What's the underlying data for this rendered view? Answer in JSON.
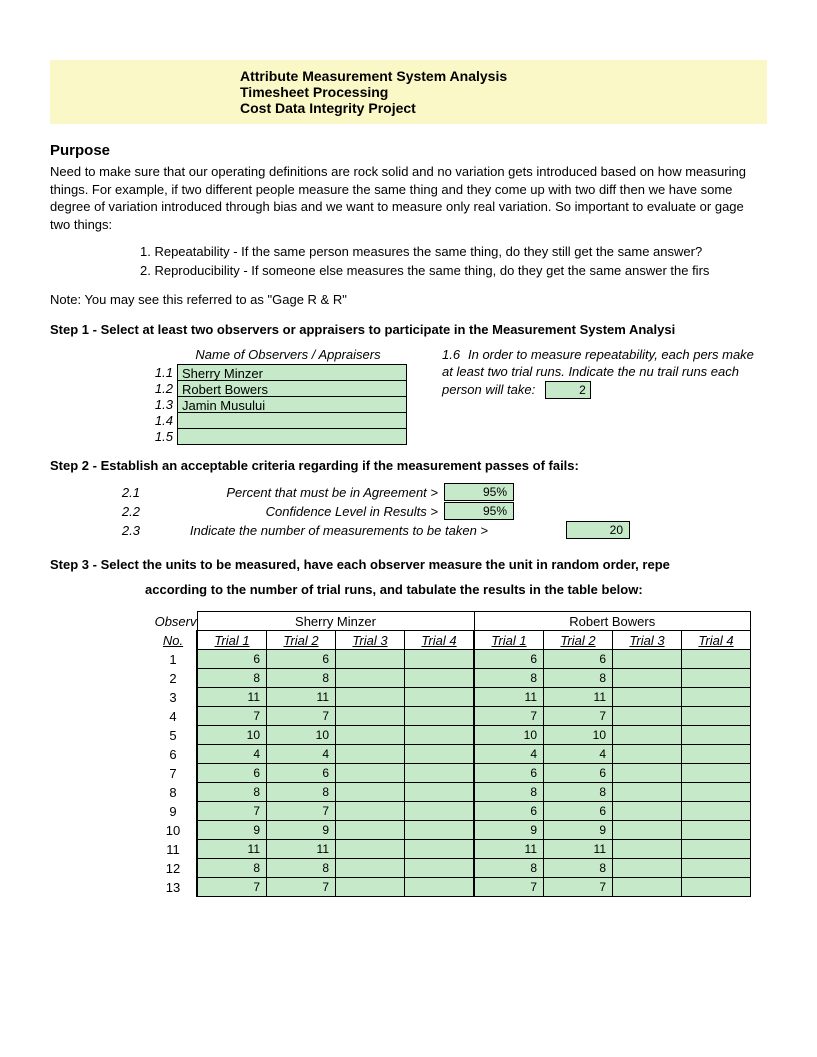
{
  "header": {
    "line1": "Attribute Measurement System Analysis",
    "line2": "Timesheet Processing",
    "line3": "Cost Data Integrity Project"
  },
  "purpose": {
    "title": "Purpose",
    "body": "Need to make sure that our operating definitions are rock solid and no variation gets introduced based on how measuring things. For example, if two different people measure the same thing and they come up with two diff then we have some degree of variation introduced through bias and we want to measure only real variation. So important to evaluate or gage two things:",
    "item1": "1. Repeatability - If the same person measures the same thing, do they still get the same answer?",
    "item2": "2. Reproducibility - If someone else measures the same thing, do they get the same answer the firs",
    "note": "Note: You may see this referred to as \"Gage R & R\""
  },
  "step1": {
    "title": "Step 1 - Select at least two observers or appraisers to participate in the Measurement System Analysi",
    "obs_header": "Name of Observers / Appraisers",
    "rows": [
      {
        "num": "1.1",
        "name": "Sherry Minzer"
      },
      {
        "num": "1.2",
        "name": "Robert Bowers"
      },
      {
        "num": "1.3",
        "name": "Jamin Musului"
      },
      {
        "num": "1.4",
        "name": ""
      },
      {
        "num": "1.5",
        "name": ""
      }
    ],
    "note_num": "1.6",
    "note_text": "In order to measure repeatability, each pers make at least two trial runs. Indicate the nu trail runs each person will take:",
    "trial_runs": "2"
  },
  "step2": {
    "title": "Step 2 - Establish an acceptable criteria regarding if the measurement passes of fails:",
    "r1": {
      "num": "2.1",
      "label": "Percent that must be in Agreement >",
      "val": "95%"
    },
    "r2": {
      "num": "2.2",
      "label": "Confidence Level in Results >",
      "val": "95%"
    },
    "r3": {
      "num": "2.3",
      "label": "Indicate the number of measurements to be taken >",
      "val": "20"
    }
  },
  "step3": {
    "title_a": "Step 3 - Select the units to be measured, have each observer measure the unit in random order, repe",
    "title_b": "according to the number of trial runs, and tabulate the results in the table below:",
    "observ_label": "Observ",
    "no_label": "No.",
    "names": [
      "Sherry Minzer",
      "Robert Bowers"
    ],
    "trials": [
      "Trial 1",
      "Trial 2",
      "Trial 3",
      "Trial 4"
    ],
    "rows": [
      {
        "no": "1",
        "a": [
          "6",
          "6",
          "",
          ""
        ],
        "b": [
          "6",
          "6",
          "",
          ""
        ]
      },
      {
        "no": "2",
        "a": [
          "8",
          "8",
          "",
          ""
        ],
        "b": [
          "8",
          "8",
          "",
          ""
        ]
      },
      {
        "no": "3",
        "a": [
          "11",
          "11",
          "",
          ""
        ],
        "b": [
          "11",
          "11",
          "",
          ""
        ]
      },
      {
        "no": "4",
        "a": [
          "7",
          "7",
          "",
          ""
        ],
        "b": [
          "7",
          "7",
          "",
          ""
        ]
      },
      {
        "no": "5",
        "a": [
          "10",
          "10",
          "",
          ""
        ],
        "b": [
          "10",
          "10",
          "",
          ""
        ]
      },
      {
        "no": "6",
        "a": [
          "4",
          "4",
          "",
          ""
        ],
        "b": [
          "4",
          "4",
          "",
          ""
        ]
      },
      {
        "no": "7",
        "a": [
          "6",
          "6",
          "",
          ""
        ],
        "b": [
          "6",
          "6",
          "",
          ""
        ]
      },
      {
        "no": "8",
        "a": [
          "8",
          "8",
          "",
          ""
        ],
        "b": [
          "8",
          "8",
          "",
          ""
        ]
      },
      {
        "no": "9",
        "a": [
          "7",
          "7",
          "",
          ""
        ],
        "b": [
          "6",
          "6",
          "",
          ""
        ]
      },
      {
        "no": "10",
        "a": [
          "9",
          "9",
          "",
          ""
        ],
        "b": [
          "9",
          "9",
          "",
          ""
        ]
      },
      {
        "no": "11",
        "a": [
          "11",
          "11",
          "",
          ""
        ],
        "b": [
          "11",
          "11",
          "",
          ""
        ]
      },
      {
        "no": "12",
        "a": [
          "8",
          "8",
          "",
          ""
        ],
        "b": [
          "8",
          "8",
          "",
          ""
        ]
      },
      {
        "no": "13",
        "a": [
          "7",
          "7",
          "",
          ""
        ],
        "b": [
          "7",
          "7",
          "",
          ""
        ]
      }
    ]
  }
}
